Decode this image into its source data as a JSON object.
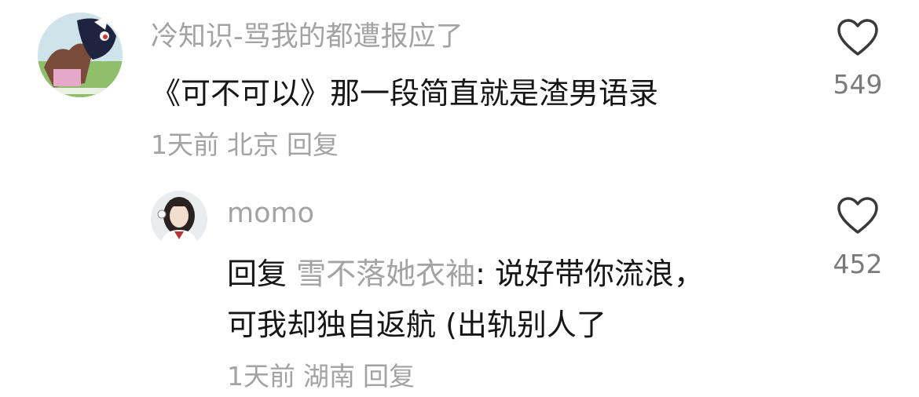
{
  "comments": [
    {
      "username": "冷知识-骂我的都遭报应了",
      "text": "《可不可以》那一段简直就是渣男语录",
      "time": "1天前",
      "location": "北京",
      "reply_label": "回复",
      "likes": "549"
    }
  ],
  "replies": [
    {
      "username": "momo",
      "reply_prefix": "回复",
      "reply_to": "雪不落她衣袖",
      "text_line1": ": 说好带你流浪，",
      "text_line2": "可我却独自返航 (出轨别人了",
      "time": "1天前",
      "location": "湖南",
      "reply_label": "回复",
      "likes": "452"
    }
  ],
  "icons": {
    "like": "heart-outline-icon"
  },
  "colors": {
    "muted_text": "#a3a3a3",
    "main_text": "#161616",
    "like_count": "#7a7a7a"
  }
}
